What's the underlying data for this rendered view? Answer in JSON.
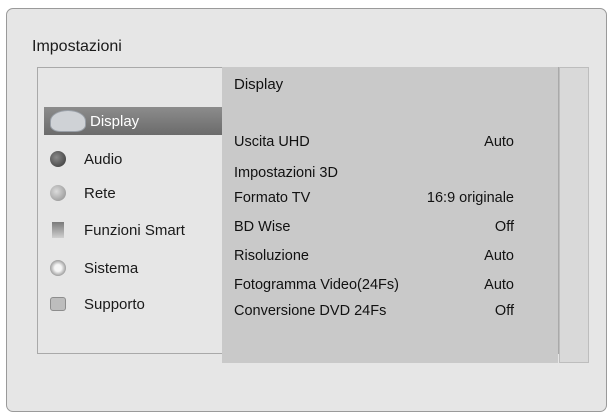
{
  "title": "Impostazioni",
  "panel": {
    "title": "Display"
  },
  "menu": [
    {
      "label": "Display",
      "icon": "display-icon",
      "active": true
    },
    {
      "label": "Audio",
      "icon": "audio-icon",
      "active": false
    },
    {
      "label": "Rete",
      "icon": "network-icon",
      "active": false
    },
    {
      "label": "Funzioni Smart",
      "icon": "smart-features-icon",
      "active": false
    },
    {
      "label": "Sistema",
      "icon": "system-icon",
      "active": false
    },
    {
      "label": "Supporto",
      "icon": "support-icon",
      "active": false
    }
  ],
  "settings": [
    {
      "label": "Uscita UHD",
      "value": "Auto"
    },
    {
      "label": "Impostazioni 3D",
      "value": ""
    },
    {
      "label": "Formato TV",
      "value": "16:9 originale"
    },
    {
      "label": "BD Wise",
      "value": "Off"
    },
    {
      "label": "Risoluzione",
      "value": "Auto"
    },
    {
      "label": "Fotogramma Video(24Fs)",
      "value": "Auto"
    },
    {
      "label": "Conversione DVD 24Fs",
      "value": "Off"
    }
  ]
}
